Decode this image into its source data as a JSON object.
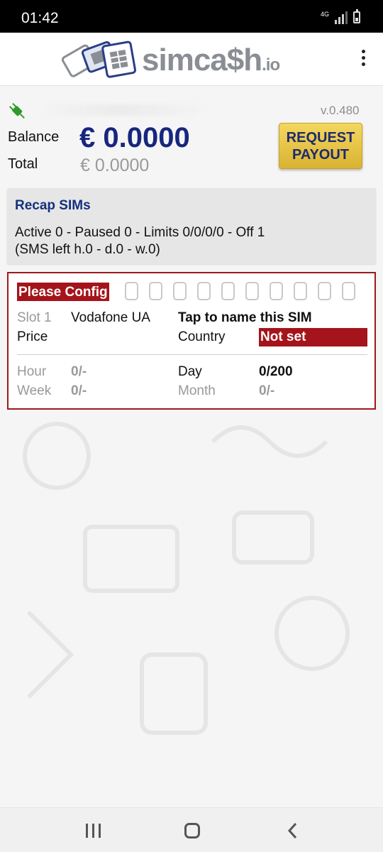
{
  "status_bar": {
    "time": "01:42",
    "network": "4G"
  },
  "app": {
    "logo_text": "simca$h",
    "logo_suffix": ".io",
    "version": "v.0.480"
  },
  "account": {
    "balance_label": "Balance",
    "balance_value": "€ 0.0000",
    "total_label": "Total",
    "total_value": "€ 0.0000",
    "payout_button": "REQUEST\nPAYOUT"
  },
  "recap": {
    "title": "Recap SIMs",
    "line1": "Active 0 - Paused 0 - Limits 0/0/0/0 - Off 1",
    "line2": "(SMS left h.0 - d.0 - w.0)"
  },
  "sim": {
    "config_badge": "Please Config",
    "slot_label": "Slot 1",
    "operator": "Vodafone UA",
    "name_prompt": "Tap to name this SIM",
    "price_label": "Price",
    "country_label": "Country",
    "country_value": "Not set",
    "stats": {
      "hour_label": "Hour",
      "hour_value": "0/-",
      "day_label": "Day",
      "day_value": "0/200",
      "week_label": "Week",
      "week_value": "0/-",
      "month_label": "Month",
      "month_value": "0/-"
    }
  },
  "colors": {
    "brand_navy": "#17267e",
    "alert_red": "#a4141a",
    "payout_gold": "#e8c548"
  },
  "icons": [
    "plug-icon",
    "more-vert-icon",
    "recent-apps-icon",
    "home-icon",
    "back-icon"
  ]
}
